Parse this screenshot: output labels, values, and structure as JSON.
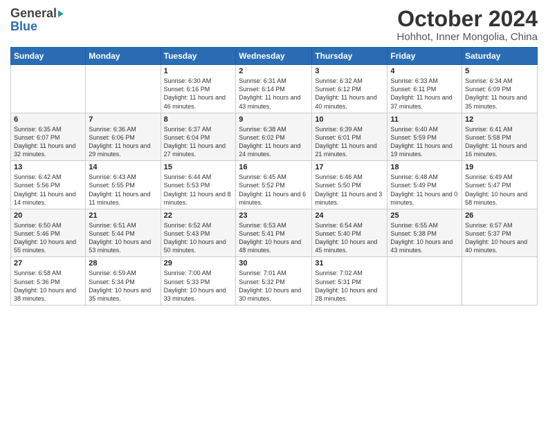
{
  "header": {
    "logo_general": "General",
    "logo_blue": "Blue",
    "title": "October 2024",
    "subtitle": "Hohhot, Inner Mongolia, China"
  },
  "weekdays": [
    "Sunday",
    "Monday",
    "Tuesday",
    "Wednesday",
    "Thursday",
    "Friday",
    "Saturday"
  ],
  "weeks": [
    [
      {
        "day": "",
        "detail": ""
      },
      {
        "day": "",
        "detail": ""
      },
      {
        "day": "1",
        "detail": "Sunrise: 6:30 AM\nSunset: 6:16 PM\nDaylight: 11 hours and 46 minutes."
      },
      {
        "day": "2",
        "detail": "Sunrise: 6:31 AM\nSunset: 6:14 PM\nDaylight: 11 hours and 43 minutes."
      },
      {
        "day": "3",
        "detail": "Sunrise: 6:32 AM\nSunset: 6:12 PM\nDaylight: 11 hours and 40 minutes."
      },
      {
        "day": "4",
        "detail": "Sunrise: 6:33 AM\nSunset: 6:11 PM\nDaylight: 11 hours and 37 minutes."
      },
      {
        "day": "5",
        "detail": "Sunrise: 6:34 AM\nSunset: 6:09 PM\nDaylight: 11 hours and 35 minutes."
      }
    ],
    [
      {
        "day": "6",
        "detail": "Sunrise: 6:35 AM\nSunset: 6:07 PM\nDaylight: 11 hours and 32 minutes."
      },
      {
        "day": "7",
        "detail": "Sunrise: 6:36 AM\nSunset: 6:06 PM\nDaylight: 11 hours and 29 minutes."
      },
      {
        "day": "8",
        "detail": "Sunrise: 6:37 AM\nSunset: 6:04 PM\nDaylight: 11 hours and 27 minutes."
      },
      {
        "day": "9",
        "detail": "Sunrise: 6:38 AM\nSunset: 6:02 PM\nDaylight: 11 hours and 24 minutes."
      },
      {
        "day": "10",
        "detail": "Sunrise: 6:39 AM\nSunset: 6:01 PM\nDaylight: 11 hours and 21 minutes."
      },
      {
        "day": "11",
        "detail": "Sunrise: 6:40 AM\nSunset: 5:59 PM\nDaylight: 11 hours and 19 minutes."
      },
      {
        "day": "12",
        "detail": "Sunrise: 6:41 AM\nSunset: 5:58 PM\nDaylight: 11 hours and 16 minutes."
      }
    ],
    [
      {
        "day": "13",
        "detail": "Sunrise: 6:42 AM\nSunset: 5:56 PM\nDaylight: 11 hours and 14 minutes."
      },
      {
        "day": "14",
        "detail": "Sunrise: 6:43 AM\nSunset: 5:55 PM\nDaylight: 11 hours and 11 minutes."
      },
      {
        "day": "15",
        "detail": "Sunrise: 6:44 AM\nSunset: 5:53 PM\nDaylight: 11 hours and 8 minutes."
      },
      {
        "day": "16",
        "detail": "Sunrise: 6:45 AM\nSunset: 5:52 PM\nDaylight: 11 hours and 6 minutes."
      },
      {
        "day": "17",
        "detail": "Sunrise: 6:46 AM\nSunset: 5:50 PM\nDaylight: 11 hours and 3 minutes."
      },
      {
        "day": "18",
        "detail": "Sunrise: 6:48 AM\nSunset: 5:49 PM\nDaylight: 11 hours and 0 minutes."
      },
      {
        "day": "19",
        "detail": "Sunrise: 6:49 AM\nSunset: 5:47 PM\nDaylight: 10 hours and 58 minutes."
      }
    ],
    [
      {
        "day": "20",
        "detail": "Sunrise: 6:50 AM\nSunset: 5:46 PM\nDaylight: 10 hours and 55 minutes."
      },
      {
        "day": "21",
        "detail": "Sunrise: 6:51 AM\nSunset: 5:44 PM\nDaylight: 10 hours and 53 minutes."
      },
      {
        "day": "22",
        "detail": "Sunrise: 6:52 AM\nSunset: 5:43 PM\nDaylight: 10 hours and 50 minutes."
      },
      {
        "day": "23",
        "detail": "Sunrise: 6:53 AM\nSunset: 5:41 PM\nDaylight: 10 hours and 48 minutes."
      },
      {
        "day": "24",
        "detail": "Sunrise: 6:54 AM\nSunset: 5:40 PM\nDaylight: 10 hours and 45 minutes."
      },
      {
        "day": "25",
        "detail": "Sunrise: 6:55 AM\nSunset: 5:38 PM\nDaylight: 10 hours and 43 minutes."
      },
      {
        "day": "26",
        "detail": "Sunrise: 6:57 AM\nSunset: 5:37 PM\nDaylight: 10 hours and 40 minutes."
      }
    ],
    [
      {
        "day": "27",
        "detail": "Sunrise: 6:58 AM\nSunset: 5:36 PM\nDaylight: 10 hours and 38 minutes."
      },
      {
        "day": "28",
        "detail": "Sunrise: 6:59 AM\nSunset: 5:34 PM\nDaylight: 10 hours and 35 minutes."
      },
      {
        "day": "29",
        "detail": "Sunrise: 7:00 AM\nSunset: 5:33 PM\nDaylight: 10 hours and 33 minutes."
      },
      {
        "day": "30",
        "detail": "Sunrise: 7:01 AM\nSunset: 5:32 PM\nDaylight: 10 hours and 30 minutes."
      },
      {
        "day": "31",
        "detail": "Sunrise: 7:02 AM\nSunset: 5:31 PM\nDaylight: 10 hours and 28 minutes."
      },
      {
        "day": "",
        "detail": ""
      },
      {
        "day": "",
        "detail": ""
      }
    ]
  ]
}
